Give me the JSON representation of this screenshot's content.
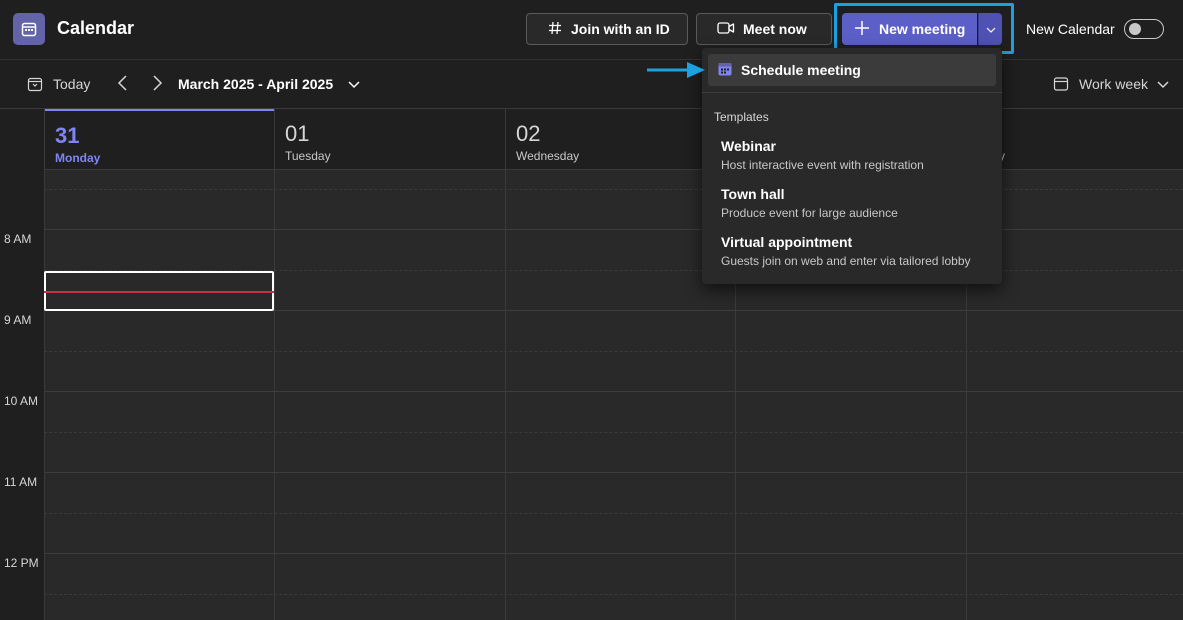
{
  "header": {
    "title": "Calendar",
    "join_label": "Join with an ID",
    "meet_label": "Meet now",
    "new_meeting_label": "New meeting",
    "new_calendar_label": "New Calendar"
  },
  "nav": {
    "today_label": "Today",
    "range_label": "March 2025 - April 2025",
    "view_label": "Work week"
  },
  "days": [
    {
      "num": "31",
      "name": "Monday"
    },
    {
      "num": "01",
      "name": "Tuesday"
    },
    {
      "num": "02",
      "name": "Wednesday"
    },
    {
      "num": "",
      "name": ""
    },
    {
      "num": "",
      "name": "y"
    }
  ],
  "times": [
    "8 AM",
    "9 AM",
    "10 AM",
    "11 AM",
    "12 PM"
  ],
  "menu": {
    "schedule_label": "Schedule meeting",
    "section_label": "Templates",
    "templates": [
      {
        "title": "Webinar",
        "desc": "Host interactive event with registration"
      },
      {
        "title": "Town hall",
        "desc": "Produce event for large audience"
      },
      {
        "title": "Virtual appointment",
        "desc": "Guests join on web and enter via tailored lobby"
      }
    ]
  },
  "colors": {
    "accent": "#5b5fc7",
    "today": "#7f85f5",
    "highlight": "#1ba1e2",
    "now_line": "#c4314b"
  }
}
